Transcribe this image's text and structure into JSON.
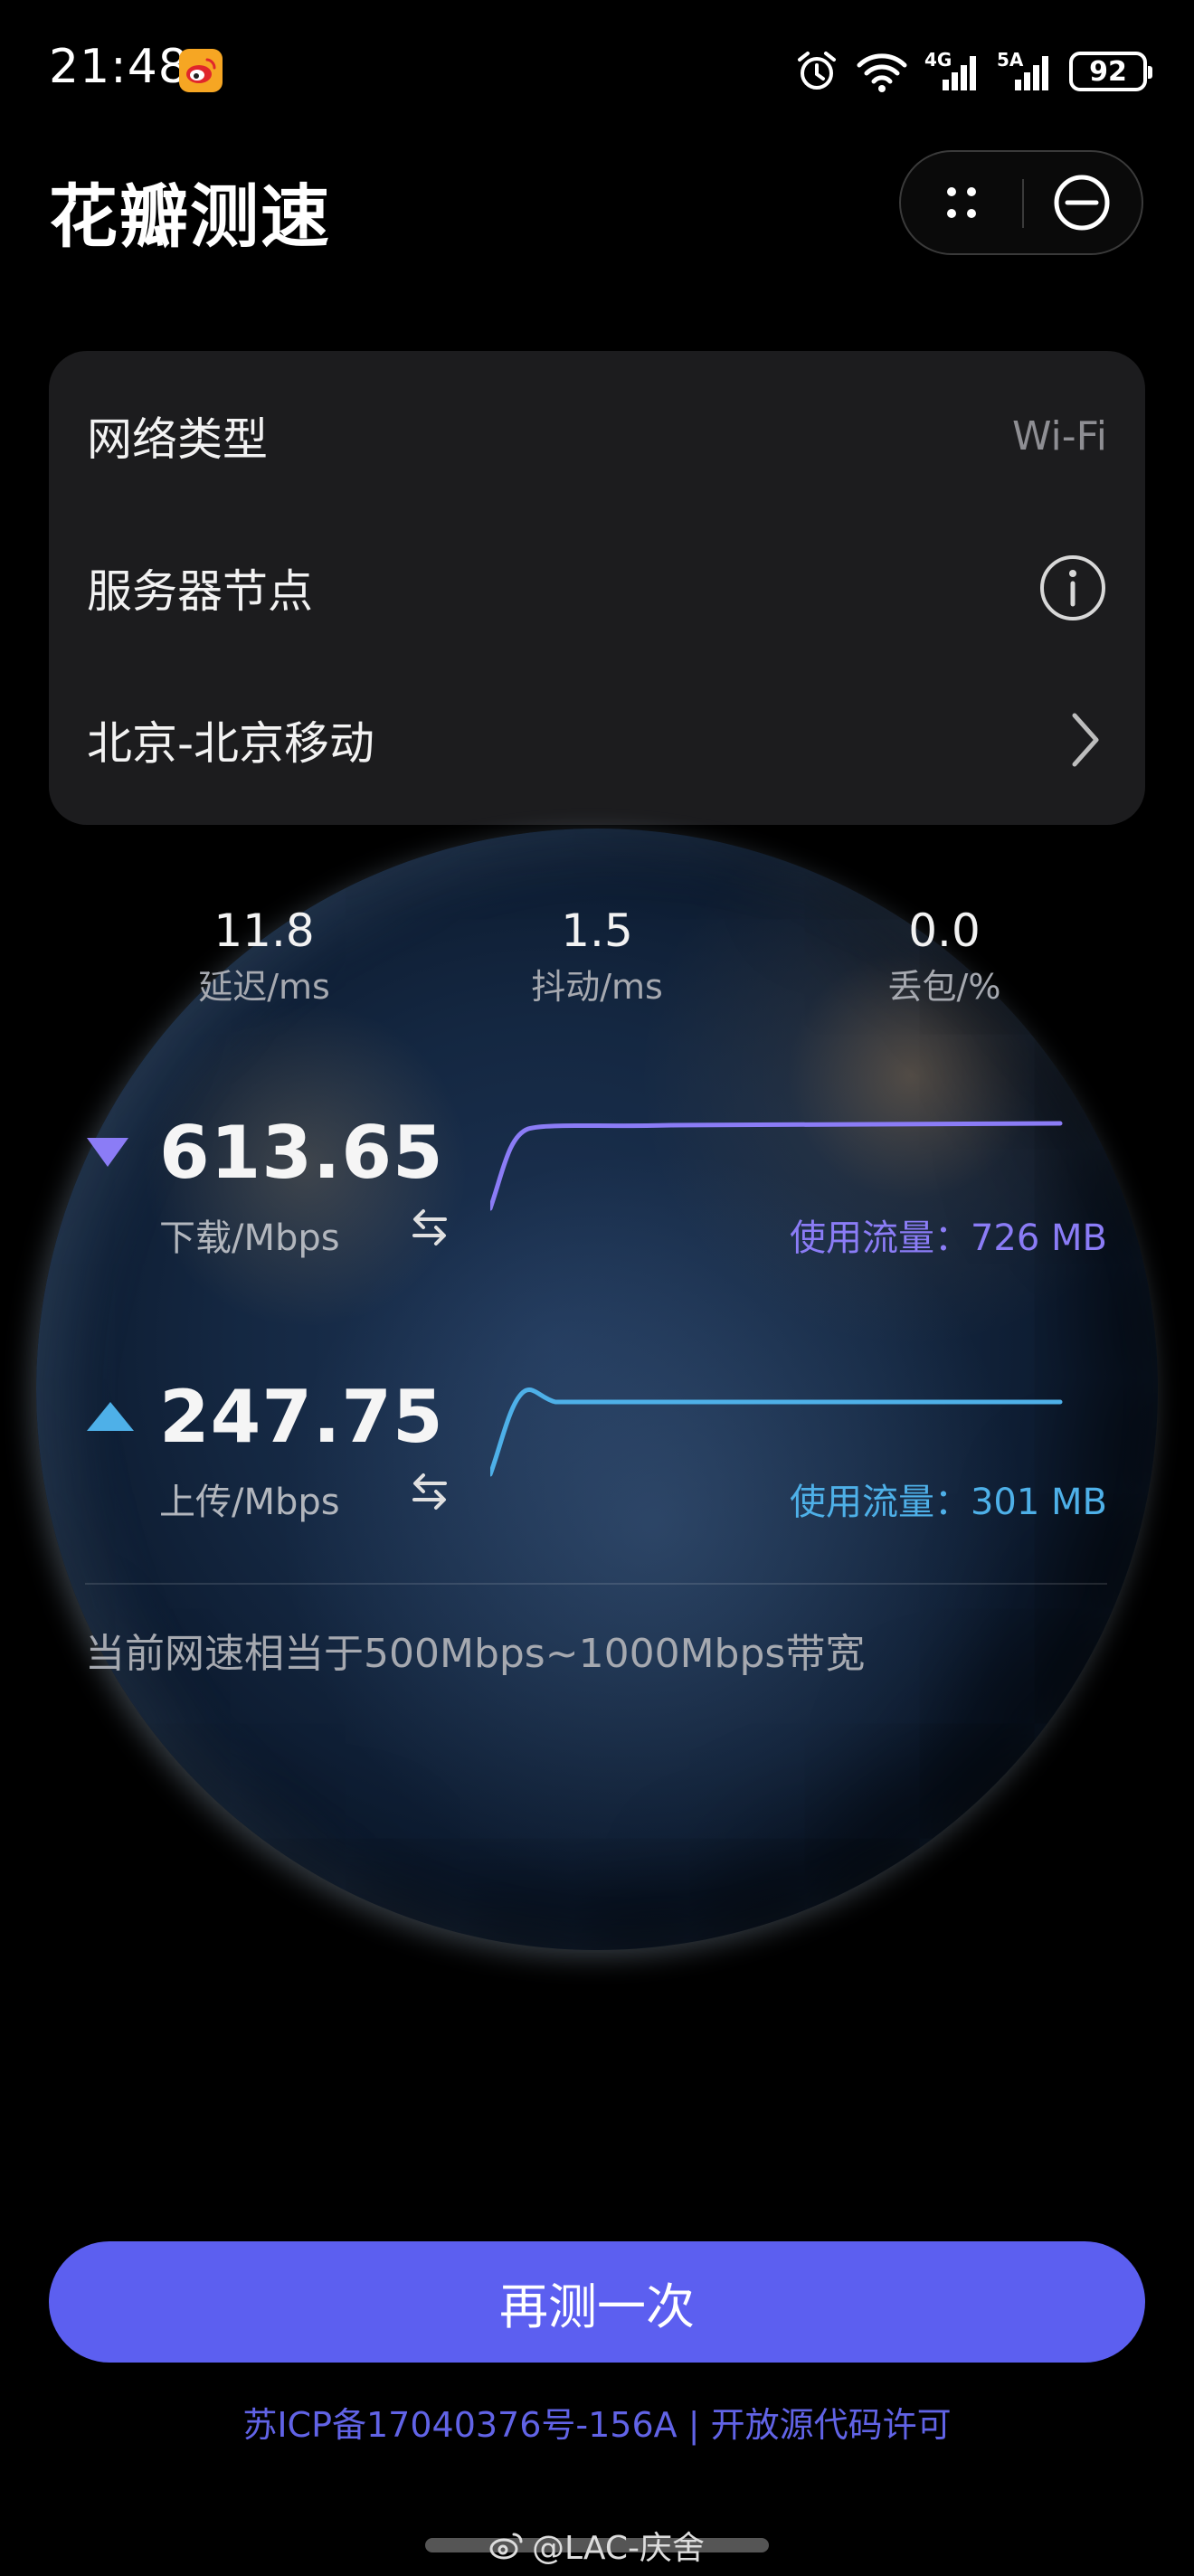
{
  "status_bar": {
    "time": "21:48",
    "network_1": "4G",
    "network_2": "5A",
    "battery": "92"
  },
  "header": {
    "title": "花瓣测速"
  },
  "info_card": {
    "network_type_label": "网络类型",
    "network_type_value": "Wi-Fi",
    "server_node_label": "服务器节点",
    "server_location": "北京-北京移动"
  },
  "metrics": {
    "latency": {
      "value": "11.8",
      "label": "延迟/ms"
    },
    "jitter": {
      "value": "1.5",
      "label": "抖动/ms"
    },
    "packet_loss": {
      "value": "0.0",
      "label": "丢包/%"
    }
  },
  "download": {
    "value": "613.65",
    "unit": "下载/Mbps",
    "usage": "使用流量：726 MB",
    "color": "#8b7cf6"
  },
  "upload": {
    "value": "247.75",
    "unit": "上传/Mbps",
    "usage": "使用流量：301 MB",
    "color": "#4eb0e8"
  },
  "bandwidth_note": "当前网速相当于500Mbps~1000Mbps带宽",
  "retest_label": "再测一次",
  "footer": {
    "icp": "苏ICP备17040376号-156A",
    "separator": "|",
    "license": "开放源代码许可"
  },
  "watermark": "@LAC-庆舍",
  "colors": {
    "accent": "#5c5ff0",
    "card": "#1c1c1e"
  }
}
